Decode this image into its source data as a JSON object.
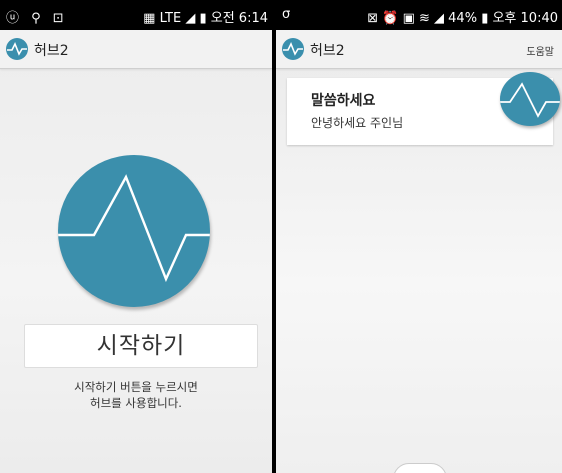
{
  "left_screen": {
    "status": {
      "left_icons": "ⓤ ⚲ ⊡",
      "right": "▦ LTE ◢ ▮ 오전 6:14"
    },
    "appbar": {
      "title": "허브2"
    },
    "start_label": "시작하기",
    "hint_line1": "시작하기 버튼을 누르시면",
    "hint_line2": "허브를 사용합니다."
  },
  "right_screen": {
    "status": {
      "left_icons": "σ",
      "right": "⊠ ⏰ ▣ ≋ ◢ 44% ▮ 오후 10:40"
    },
    "appbar": {
      "title": "허브2",
      "help_label": "도움말"
    },
    "card": {
      "title": "말씀하세요",
      "subtitle": "안녕하세요 주인님"
    }
  },
  "icons": {
    "logo": "pulse-icon"
  },
  "colors": {
    "accent": "#3b8fac",
    "statusbar": "#000000",
    "background": "#efefef"
  }
}
